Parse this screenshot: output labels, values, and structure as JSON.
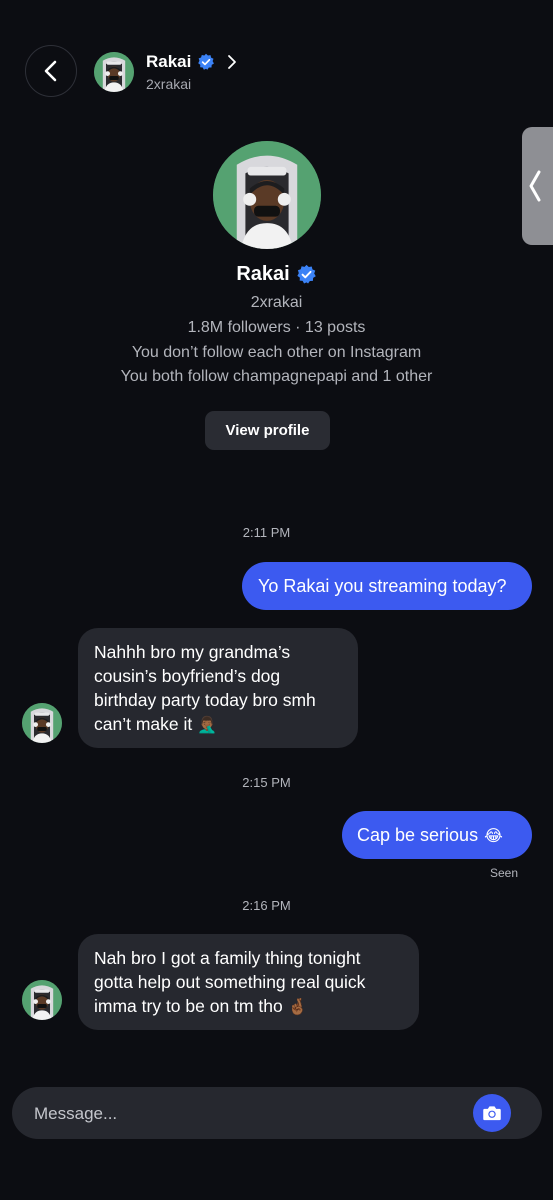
{
  "header": {
    "name": "Rakai",
    "handle": "2xrakai",
    "back_icon": "chevron-left-icon",
    "verified_icon": "verified-badge-icon"
  },
  "profile": {
    "name": "Rakai",
    "handle": "2xrakai",
    "stats": "1.8M followers · 13 posts",
    "follow_status": "You don’t follow each other on Instagram",
    "mutual": "You both follow champagnepapi and 1 other",
    "view_profile_label": "View profile"
  },
  "messages": {
    "time1": "2:11 PM",
    "out1": "Yo Rakai you streaming today?",
    "in1": "Nahhh bro my grandma’s cousin’s boyfriend’s dog birthday party today bro smh can’t make it",
    "in1_emoji": "🤦🏾‍♂️",
    "time2": "2:15 PM",
    "out2": "Cap be serious",
    "out2_emoji": "😂",
    "seen": "Seen",
    "time3": "2:16 PM",
    "in2": "Nah bro I got a family thing tonight gotta help out something real quick imma try to be on tm tho",
    "in2_emoji": "🤞🏾"
  },
  "composer": {
    "placeholder": "Message...",
    "camera_icon": "camera-icon"
  },
  "colors": {
    "background": "#0c0d12",
    "outgoing_bubble": "#3c5af0",
    "incoming_bubble": "#26282f",
    "verified": "#3b82f6"
  }
}
